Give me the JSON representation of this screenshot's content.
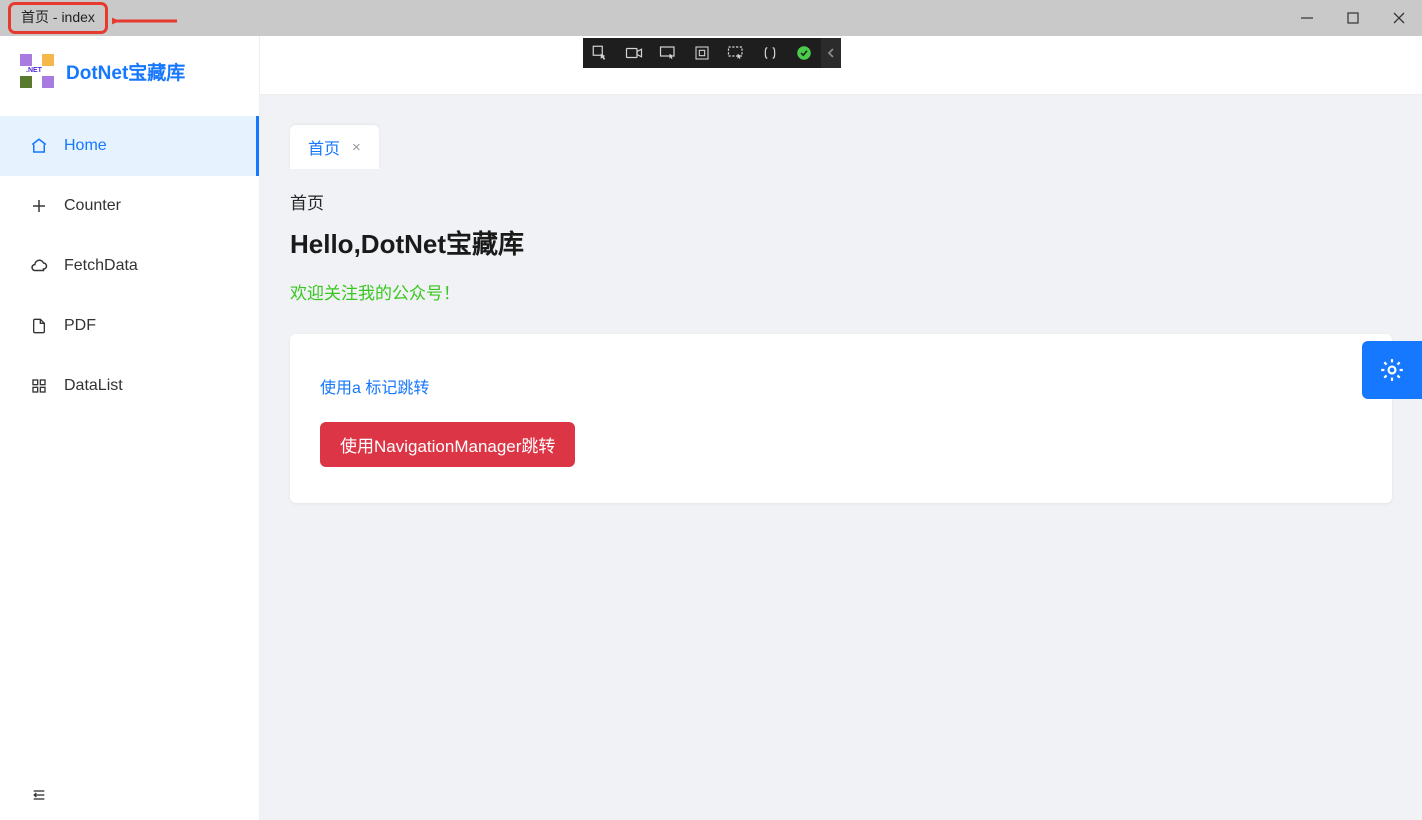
{
  "window": {
    "title": "首页 - index"
  },
  "brand": {
    "name": "DotNet宝藏库"
  },
  "sidebar": {
    "items": [
      {
        "label": "Home",
        "icon": "home-icon",
        "active": true
      },
      {
        "label": "Counter",
        "icon": "plus-icon",
        "active": false
      },
      {
        "label": "FetchData",
        "icon": "cloud-icon",
        "active": false
      },
      {
        "label": "PDF",
        "icon": "file-icon",
        "active": false
      },
      {
        "label": "DataList",
        "icon": "grid-icon",
        "active": false
      }
    ]
  },
  "tabs": [
    {
      "label": "首页"
    }
  ],
  "page": {
    "breadcrumb": "首页",
    "heading": "Hello,DotNet宝藏库",
    "welcome": "欢迎关注我的公众号！",
    "link_a": "使用a 标记跳转",
    "button_nav": "使用NavigationManager跳转"
  }
}
